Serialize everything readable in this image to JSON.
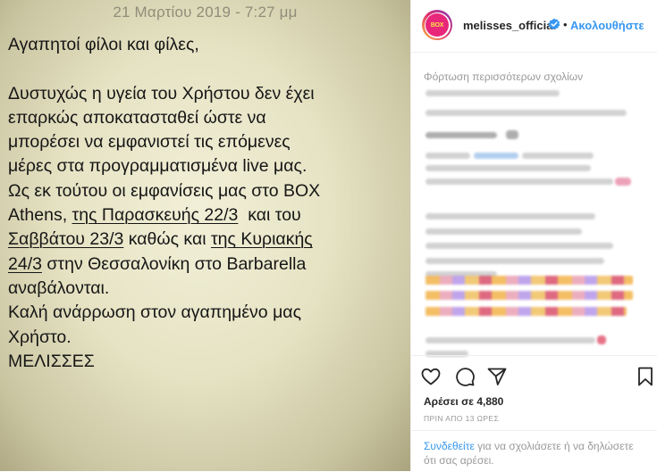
{
  "photo": {
    "date": "21 Μαρτίου 2019 - 7:27 μμ",
    "note": {
      "l1": "Αγαπητοί φίλοι και φίλες,",
      "l2": "Δυστυχώς η υγεία του Χρήστου δεν έχει",
      "l3": "επαρκώς αποκατασταθεί ώστε να",
      "l4": "μπορέσει να εμφανιστεί τις επόμενες",
      "l5": "μέρες στα προγραμματισμένα live μας.",
      "l6": "Ως εκ τούτου οι εμφανίσεις μας στο BOX",
      "l7a": "Athens, ",
      "l7b": "της Παρασκευής 22/3",
      "l7c": "  και του",
      "l8a": "Σαββάτου 23/3",
      "l8b": " καθώς και ",
      "l8c": "της Κυριακής",
      "l9a": "24/3",
      "l9b": " στην Θεσσαλονίκη στο Barbarella",
      "l10": "αναβάλονται.",
      "l11": "Καλή ανάρρωση στον αγαπημένο μας",
      "l12": "Χρήστο.",
      "l13": "ΜΕΛΙΣΣΕΣ"
    }
  },
  "header": {
    "avatar_text": "BOX",
    "username": "melisses_official",
    "separator": "•",
    "follow_label": "Ακολουθήστε"
  },
  "comments": {
    "load_more": "Φόρτωση περισσότερων σχολίων"
  },
  "actions": {
    "icons": [
      "heart-icon",
      "comment-icon",
      "share-icon",
      "bookmark-icon"
    ]
  },
  "likes": "Αρέσει σε 4,880",
  "time": "ΠΡΙΝ ΑΠΟ 13 ΩΡΕΣ",
  "footer": {
    "login_label": "Συνδεθείτε",
    "rest": " για να σχολιάσετε ή να δηλώσετε ότι σας αρέσει."
  },
  "colors": {
    "accent": "#3897f0",
    "text": "#262626",
    "muted": "#999999"
  }
}
